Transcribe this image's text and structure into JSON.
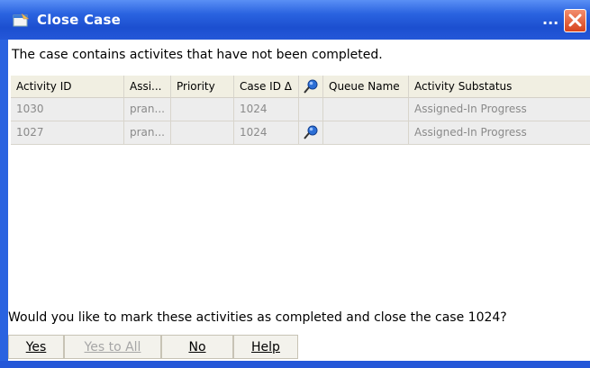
{
  "window": {
    "title": "Close Case",
    "title_overflow": "...",
    "colors": {
      "titlebar": "#2457d8",
      "close_button": "#d7431c"
    }
  },
  "message": "The case contains activites that have not been completed.",
  "grid": {
    "columns": [
      {
        "label": "Activity ID"
      },
      {
        "label": "Assi..."
      },
      {
        "label": "Priority"
      },
      {
        "label": "Case ID Δ"
      },
      {
        "label": "",
        "icon": "pin-icon"
      },
      {
        "label": "Queue Name"
      },
      {
        "label": "Activity Substatus"
      }
    ],
    "rows": [
      {
        "activity_id": "1030",
        "assigned": "pran...",
        "priority": "",
        "case_id": "1024",
        "pinned": false,
        "queue_name": "",
        "substatus": "Assigned-In Progress"
      },
      {
        "activity_id": "1027",
        "assigned": "pran...",
        "priority": "",
        "case_id": "1024",
        "pinned": true,
        "queue_name": "",
        "substatus": "Assigned-In Progress"
      }
    ]
  },
  "question": "Would you like to mark these activities as completed and close the case 1024?",
  "buttons": {
    "yes": "Yes",
    "yes_to_all": "Yes to All",
    "no": "No",
    "help": "Help"
  }
}
